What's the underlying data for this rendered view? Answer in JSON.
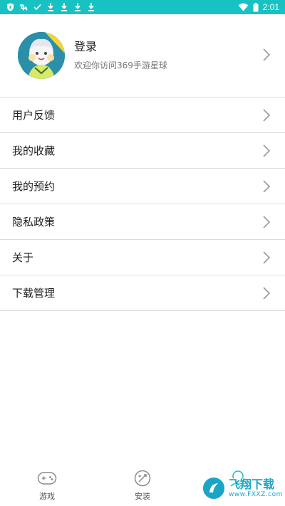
{
  "status_bar": {
    "time": "2:01",
    "bg_color": "#19c2c2",
    "left_icons": [
      "shield-icon",
      "app-icon",
      "check-icon",
      "download-icon",
      "download-icon",
      "download-icon",
      "download-icon"
    ],
    "right_icons": [
      "wifi-icon",
      "battery-icon"
    ]
  },
  "profile": {
    "title": "登录",
    "subtitle": "欢迎你访问369手游星球"
  },
  "menu": {
    "items": [
      {
        "label": "用户反馈"
      },
      {
        "label": "我的收藏"
      },
      {
        "label": "我的预约"
      },
      {
        "label": "隐私政策"
      },
      {
        "label": "关于"
      },
      {
        "label": "下载管理"
      }
    ]
  },
  "bottom_nav": {
    "items": [
      {
        "label": "游戏",
        "icon": "gamepad-icon"
      },
      {
        "label": "安装",
        "icon": "install-icon"
      },
      {
        "label": "",
        "icon": "profile-icon"
      }
    ]
  },
  "watermark": {
    "text": "飞翔下载",
    "url_text": "www.FXXZ.com"
  }
}
